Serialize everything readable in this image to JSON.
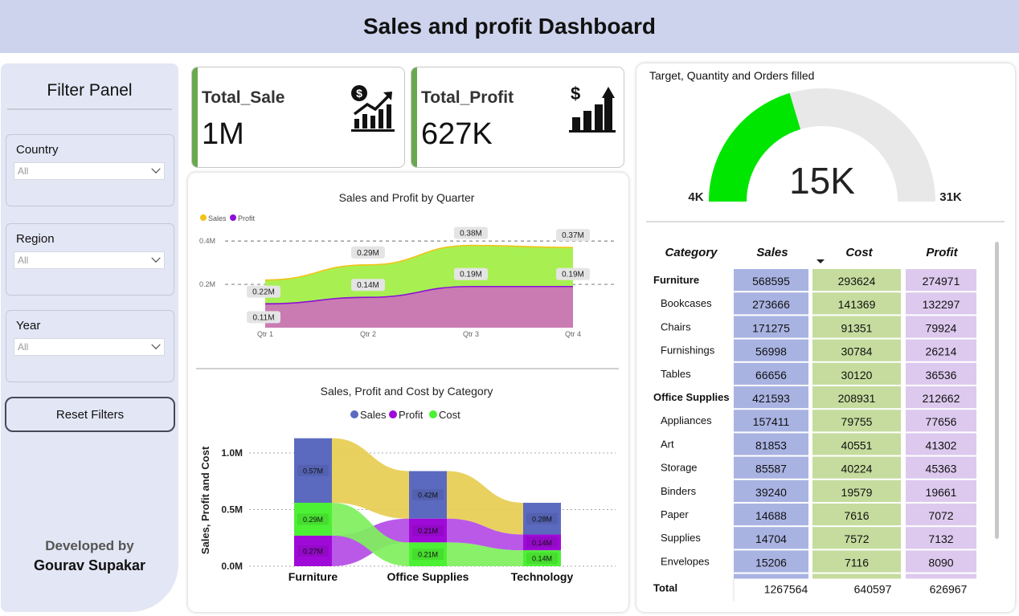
{
  "title": "Sales and profit Dashboard",
  "filter_panel": {
    "heading": "Filter Panel",
    "slicers": [
      {
        "label": "Country",
        "value": "All"
      },
      {
        "label": "Region",
        "value": "All"
      },
      {
        "label": "Year",
        "value": "All"
      }
    ],
    "reset_label": "Reset Filters",
    "developed_by": "Developed by",
    "developer": "Gourav Supakar"
  },
  "cards": [
    {
      "label": "Total_Sale",
      "value": "1M",
      "icon": "dollar-growth-chart-icon"
    },
    {
      "label": "Total_Profit",
      "value": "627K",
      "icon": "dollar-bar-growth-icon"
    }
  ],
  "gauge": {
    "title": "Target, Quantity and Orders filled",
    "min_label": "4K",
    "max_label": "31K",
    "value_label": "15K",
    "min": 4000,
    "max": 31000,
    "value": 15000,
    "fill_color": "#00e600",
    "track_color": "#e8e8e8"
  },
  "matrix": {
    "headers": [
      "Category",
      "Sales",
      "Cost",
      "Profit"
    ],
    "rows": [
      {
        "name": "Furniture",
        "group": true,
        "sales": "568595",
        "cost": "293624",
        "profit": "274971"
      },
      {
        "name": "Bookcases",
        "group": false,
        "sales": "273666",
        "cost": "141369",
        "profit": "132297"
      },
      {
        "name": "Chairs",
        "group": false,
        "sales": "171275",
        "cost": "91351",
        "profit": "79924"
      },
      {
        "name": "Furnishings",
        "group": false,
        "sales": "56998",
        "cost": "30784",
        "profit": "26214"
      },
      {
        "name": "Tables",
        "group": false,
        "sales": "66656",
        "cost": "30120",
        "profit": "36536"
      },
      {
        "name": "Office Supplies",
        "group": true,
        "sales": "421593",
        "cost": "208931",
        "profit": "212662"
      },
      {
        "name": "Appliances",
        "group": false,
        "sales": "157411",
        "cost": "79755",
        "profit": "77656"
      },
      {
        "name": "Art",
        "group": false,
        "sales": "81853",
        "cost": "40551",
        "profit": "41302"
      },
      {
        "name": "Storage",
        "group": false,
        "sales": "85587",
        "cost": "40224",
        "profit": "45363"
      },
      {
        "name": "Binders",
        "group": false,
        "sales": "39240",
        "cost": "19579",
        "profit": "19661"
      },
      {
        "name": "Paper",
        "group": false,
        "sales": "14688",
        "cost": "7616",
        "profit": "7072"
      },
      {
        "name": "Supplies",
        "group": false,
        "sales": "14704",
        "cost": "7572",
        "profit": "7132"
      },
      {
        "name": "Envelopes",
        "group": false,
        "sales": "15206",
        "cost": "7116",
        "profit": "8090"
      }
    ],
    "total": {
      "label": "Total",
      "sales": "1267564",
      "cost": "640597",
      "profit": "626967"
    },
    "colors": {
      "sales": "#a9b3e2",
      "cost": "#c5dc9e",
      "profit": "#ddc9ee"
    }
  },
  "chart_data": [
    {
      "type": "area",
      "title": "Sales and Profit by Quarter",
      "categories": [
        "Qtr 1",
        "Qtr 2",
        "Qtr 3",
        "Qtr 4"
      ],
      "series": [
        {
          "name": "Sales",
          "values": [
            0.22,
            0.29,
            0.38,
            0.37
          ],
          "labels": [
            "0.22M",
            "0.29M",
            "0.38M",
            "0.37M"
          ],
          "color": "#f2c318",
          "fill": "#a8f052"
        },
        {
          "name": "Profit",
          "values": [
            0.11,
            0.14,
            0.19,
            0.19
          ],
          "labels": [
            "0.11M",
            "0.14M",
            "0.19M",
            "0.19M"
          ],
          "color": "#8b10d6",
          "fill": "#c97bb2"
        }
      ],
      "yticks": [
        "0.2M",
        "0.4M"
      ],
      "ytick_values": [
        0.2,
        0.4
      ],
      "ylim": [
        0,
        0.43
      ],
      "legend": "top-left"
    },
    {
      "type": "ribbon",
      "title": "Sales, Profit and Cost by Category",
      "ylabel": "Sales, Profit and Cost",
      "categories": [
        "Furniture",
        "Office Supplies",
        "Technology"
      ],
      "series": [
        {
          "name": "Sales",
          "values": [
            0.57,
            0.42,
            0.28
          ],
          "labels": [
            "0.57M",
            "0.42M",
            "0.28M"
          ],
          "color": "#5b6abf",
          "ribbon": "#e7cd52"
        },
        {
          "name": "Profit",
          "values": [
            0.27,
            0.21,
            0.14
          ],
          "labels": [
            "0.27M",
            "0.21M",
            "0.14M"
          ],
          "color": "#a00ad8",
          "ribbon": "#b44be6"
        },
        {
          "name": "Cost",
          "values": [
            0.29,
            0.21,
            0.14
          ],
          "labels": [
            "0.29M",
            "0.21M",
            "0.14M"
          ],
          "color": "#4cf034",
          "ribbon": "#7ef05c"
        }
      ],
      "yticks": [
        "0.0M",
        "0.5M",
        "1.0M"
      ],
      "ytick_values": [
        0,
        0.5,
        1.0
      ],
      "ylim": [
        0,
        1.2
      ],
      "legend": "top-center"
    }
  ]
}
